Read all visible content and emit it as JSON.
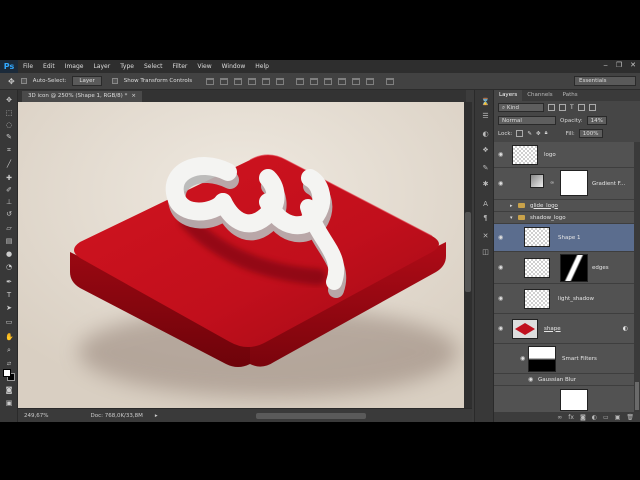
{
  "app": {
    "logo": "Ps",
    "window_controls": [
      "‒",
      "❐",
      "✕"
    ]
  },
  "menu": [
    "File",
    "Edit",
    "Image",
    "Layer",
    "Type",
    "Select",
    "Filter",
    "View",
    "Window",
    "Help"
  ],
  "options_bar": {
    "auto_select_label": "Auto-Select:",
    "auto_select_value": "Layer",
    "transform_label": "Show Transform Controls",
    "workspace": "Essentials"
  },
  "document": {
    "tab_title": "3D icon @ 250% (Shape 1, RGB/8) *",
    "close": "×",
    "artwork_letters": "cw"
  },
  "status": {
    "zoom": "249,67%",
    "doc_info": "Doc: 768,0K/33,8M"
  },
  "layers_panel": {
    "tabs": [
      "Layers",
      "Channels",
      "Paths"
    ],
    "filter_kind": "Kind",
    "blend_mode": "Normal",
    "opacity_label": "Opacity:",
    "opacity_value": "14%",
    "lock_label": "Lock:",
    "fill_label": "Fill:",
    "fill_value": "100%",
    "layers": [
      {
        "name": "logo"
      },
      {
        "name": "Gradient F..."
      },
      {
        "name": "glide_logo"
      },
      {
        "name": "shadow_logo"
      },
      {
        "name": "Shape 1"
      },
      {
        "name": "edges"
      },
      {
        "name": "light_shadow"
      },
      {
        "name": "shape"
      },
      {
        "name": "Smart Filters"
      },
      {
        "name": "Gaussian Blur"
      }
    ]
  },
  "colors": {
    "panel_bg": "#464646",
    "selected_layer": "#5b6d8e",
    "accent": "#31a8ff",
    "tile_red": "#c0101e"
  }
}
